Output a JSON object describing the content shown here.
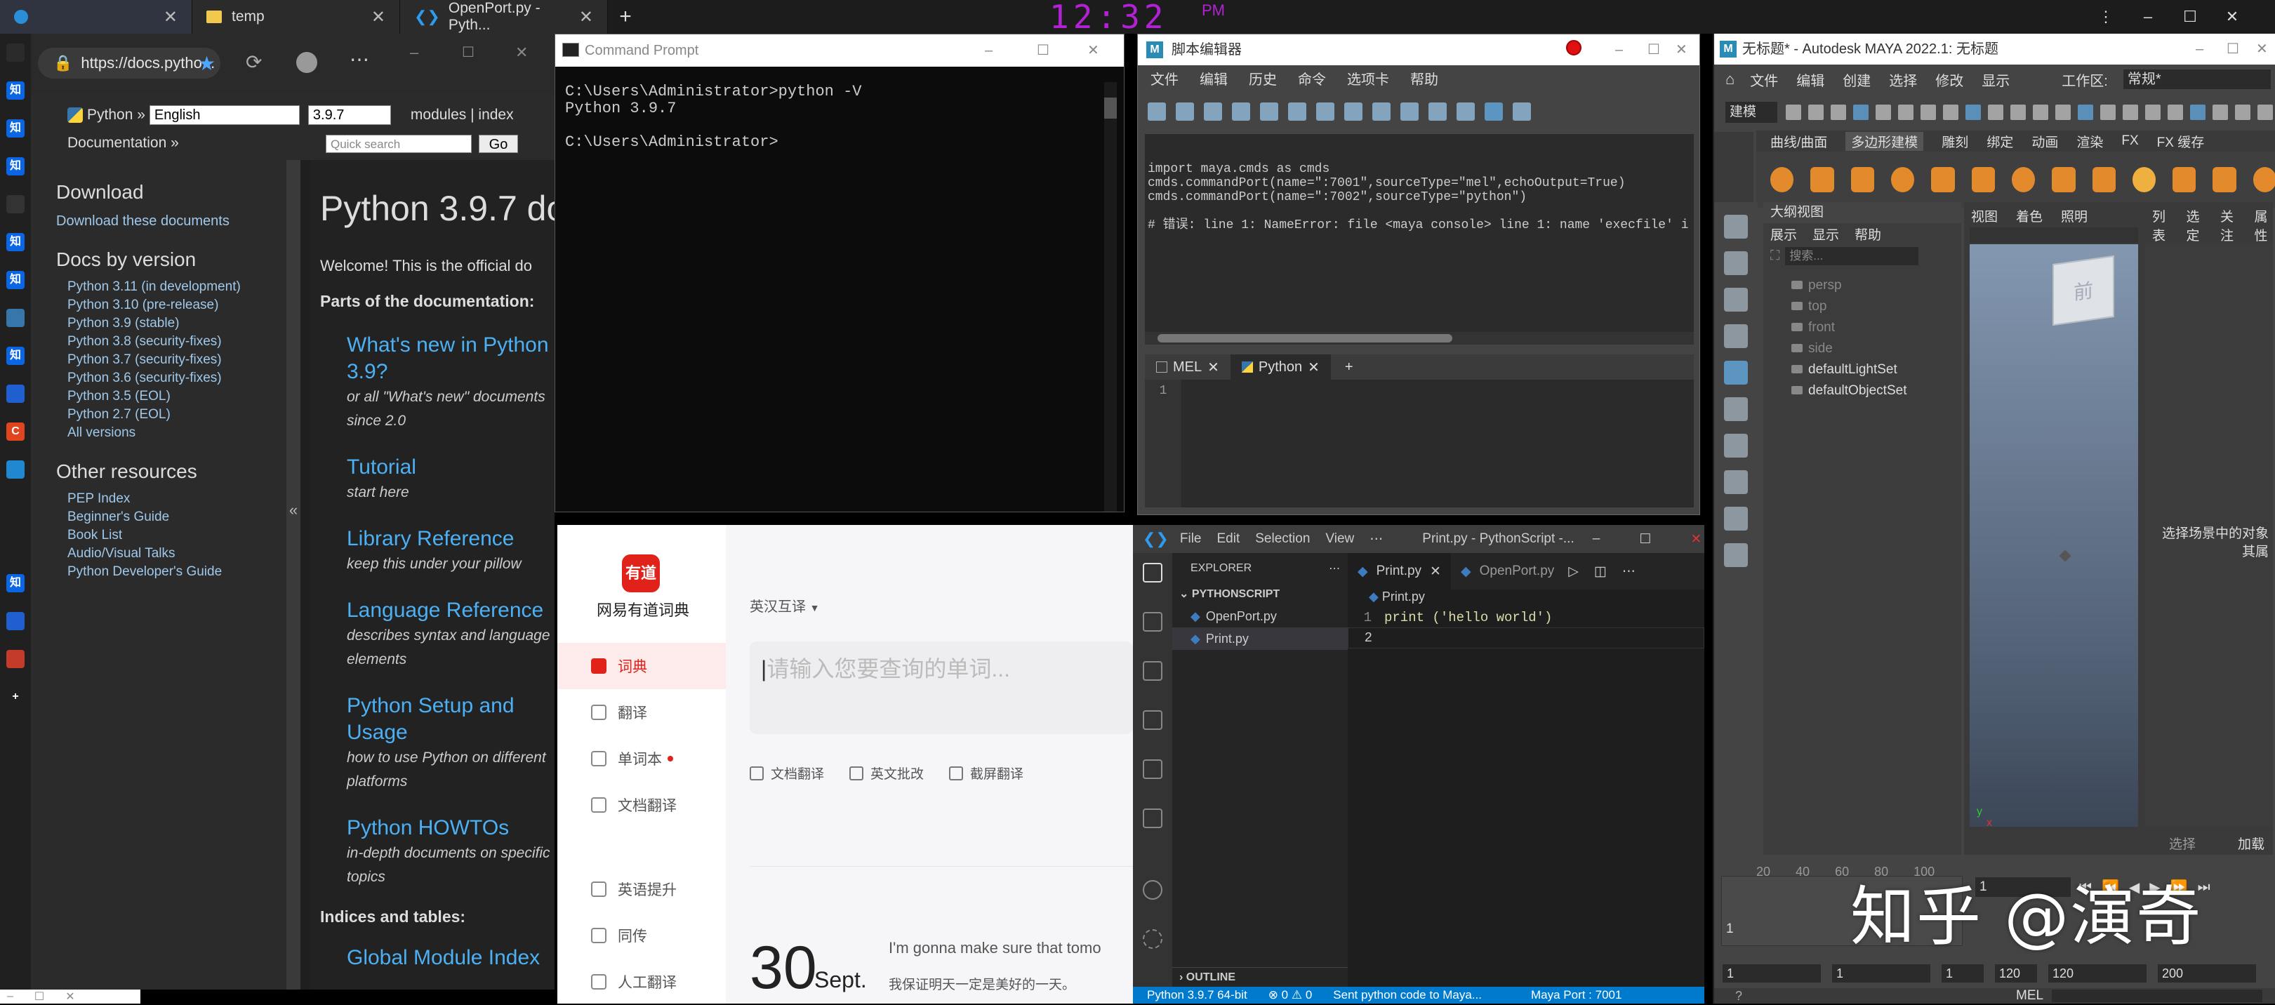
{
  "taskbar": {
    "tabs": [
      {
        "label": ""
      },
      {
        "label": "temp"
      },
      {
        "label": "OpenPort.py - Pyth..."
      }
    ],
    "new_tab": "+",
    "clock": "12:32",
    "ampm": "PM",
    "controls": [
      "⋮",
      "–",
      "☐",
      "✕"
    ]
  },
  "side_icons": [
    {
      "label": "",
      "color": "#2b2b2b"
    },
    {
      "label": "知",
      "color": "#0a66e4"
    },
    {
      "label": "知",
      "color": "#0a66e4"
    },
    {
      "label": "知",
      "color": "#0a66e4"
    },
    {
      "label": "",
      "color": "#333"
    },
    {
      "label": "知",
      "color": "#0a66e4"
    },
    {
      "label": "知",
      "color": "#0a66e4"
    },
    {
      "label": "",
      "color": "#3776ab"
    },
    {
      "label": "知",
      "color": "#0a66e4"
    },
    {
      "label": "",
      "color": "#1f5fd0"
    },
    {
      "label": "C",
      "color": "#e0451f"
    },
    {
      "label": "",
      "color": "#1f88d0"
    },
    {
      "label": "",
      "color": "#202020"
    },
    {
      "label": "",
      "color": "#202020"
    },
    {
      "label": "知",
      "color": "#0a66e4"
    },
    {
      "label": "",
      "color": "#1f5fd0"
    },
    {
      "label": "",
      "color": "#c43b2a"
    },
    {
      "label": "+",
      "color": "#202020"
    }
  ],
  "pydocs": {
    "url": "https://docs.pytho...",
    "breadcrumb": "Python »",
    "lang": "English",
    "version": "3.9.7",
    "nav_right": "modules | index",
    "documentation": "Documentation »",
    "search_placeholder": "Quick search",
    "go": "Go",
    "sidebar": {
      "download_title": "Download",
      "download_link": "Download these documents",
      "versions_title": "Docs by version",
      "versions": [
        "Python 3.11 (in development)",
        "Python 3.10 (pre-release)",
        "Python 3.9 (stable)",
        "Python 3.8 (security-fixes)",
        "Python 3.7 (security-fixes)",
        "Python 3.6 (security-fixes)",
        "Python 3.5 (EOL)",
        "Python 2.7 (EOL)",
        "All versions"
      ],
      "other_title": "Other resources",
      "other": [
        "PEP Index",
        "Beginner's Guide",
        "Book List",
        "Audio/Visual Talks",
        "Python Developer's Guide"
      ],
      "collapse": "«"
    },
    "main": {
      "title": "Python 3.9.7 do",
      "welcome": "Welcome! This is the official do",
      "parts": "Parts of the documentation:",
      "links": [
        {
          "title": "What's new in Python 3.9?",
          "sub": "or all \"What's new\" documents since 2.0"
        },
        {
          "title": "Tutorial",
          "sub": "start here"
        },
        {
          "title": "Library Reference",
          "sub": "keep this under your pillow"
        },
        {
          "title": "Language Reference",
          "sub": "describes syntax and language elements"
        },
        {
          "title": "Python Setup and Usage",
          "sub": "how to use Python on different platforms"
        },
        {
          "title": "Python HOWTOs",
          "sub": "in-depth documents on specific topics"
        }
      ],
      "indices": "Indices and tables:",
      "global_index": "Global Module Index"
    }
  },
  "cmd": {
    "title": "Command Prompt",
    "lines": "C:\\Users\\Administrator>python -V\nPython 3.9.7\n\nC:\\Users\\Administrator>"
  },
  "script_editor": {
    "title": "脚本编辑器",
    "menu": [
      "文件",
      "编辑",
      "历史",
      "命令",
      "选项卡",
      "帮助"
    ],
    "output": "import maya.cmds as cmds\ncmds.commandPort(name=\":7001\",sourceType=\"mel\",echoOutput=True)\ncmds.commandPort(name=\":7002\",sourceType=\"python\")\n\n# 错误: line 1: NameError: file <maya console> line 1: name 'execfile' i",
    "tabs": [
      "MEL",
      "Python"
    ],
    "line1": "1"
  },
  "maya": {
    "title": "无标题* - Autodesk MAYA 2022.1: 无标题",
    "menu": [
      "文件",
      "编辑",
      "创建",
      "选择",
      "修改",
      "显示"
    ],
    "workspace_label": "工作区:",
    "workspace": "常规*",
    "mode": "建模",
    "shelf_tabs": [
      "曲线/曲面",
      "多边形建模",
      "雕刻",
      "绑定",
      "动画",
      "渲染",
      "FX",
      "FX 缓存"
    ],
    "outliner_title": "大纲视图",
    "outliner_menu": [
      "展示",
      "显示",
      "帮助"
    ],
    "search": "搜索...",
    "outliner_items": [
      "persp",
      "top",
      "front",
      "side",
      "defaultLightSet",
      "defaultObjectSet"
    ],
    "viewport_menu": [
      "视图",
      "着色",
      "照明"
    ],
    "right_panel_menu": [
      "列表",
      "选定",
      "关注",
      "属性"
    ],
    "right_hint": "选择场景中的对象\n其属",
    "select_btn": "选择",
    "load_btn": "加载属",
    "timeline_ticks": [
      "20",
      "40",
      "60",
      "80",
      "100"
    ],
    "frame_current": "1",
    "frame_left": "1",
    "range": [
      "1",
      "1",
      "1",
      "120",
      "120",
      "200"
    ],
    "mel_label": "MEL",
    "axis_y": "y",
    "axis_x": "x"
  },
  "youdao": {
    "logo_text": "有道",
    "app_name": "网易有道词典",
    "lang_select": "英汉互译",
    "search_placeholder": "请输入您要查询的单词...",
    "nav": [
      {
        "label": "词典",
        "active": true
      },
      {
        "label": "翻译"
      },
      {
        "label": "单词本"
      },
      {
        "label": "文档翻译"
      },
      {
        "label": "英语提升"
      },
      {
        "label": "同传"
      },
      {
        "label": "人工翻译"
      }
    ],
    "actions": [
      "文档翻译",
      "英文批改",
      "截屏翻译"
    ],
    "day": "30",
    "month": "Sept.",
    "quote_en": "I'm gonna make sure that tomo",
    "quote_cn": "我保证明天一定是美好的一天。"
  },
  "vscode": {
    "menu": [
      "File",
      "Edit",
      "Selection",
      "View",
      "⋯"
    ],
    "title": "Print.py - PythonScript -...",
    "explorer": "EXPLORER",
    "project": "PYTHONSCRIPT",
    "files": [
      "OpenPort.py",
      "Print.py"
    ],
    "outline": "OUTLINE",
    "tabs": [
      "Print.py",
      "OpenPort.py"
    ],
    "breadcrumb": "Print.py",
    "lines": [
      {
        "n": "1",
        "code": "print ('hello world')"
      },
      {
        "n": "2",
        "code": ""
      }
    ],
    "status": {
      "python": "Python 3.9.7 64-bit",
      "problems": "⊗ 0 ⚠ 0",
      "message": "Sent python code to Maya...",
      "port": "Maya Port : 7001"
    }
  },
  "watermark": "知乎 @演奇",
  "colors": {
    "docs_link": "#4cb0f4",
    "youdao_red": "#e0221a",
    "vscode_blue": "#007acc",
    "clock_purple": "#b222d4",
    "maya_accent": "#5fa3d6"
  }
}
